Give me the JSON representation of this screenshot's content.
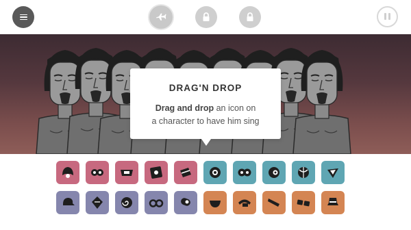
{
  "topbar": {
    "menu_icon": "hamburger-menu-icon",
    "modes": [
      {
        "name": "airplane-mode",
        "icon": "airplane-icon",
        "locked": false
      },
      {
        "name": "locked-mode-1",
        "icon": "lock-icon",
        "locked": true
      },
      {
        "name": "locked-mode-2",
        "icon": "lock-icon",
        "locked": true
      }
    ],
    "pause_icon": "pause-icon"
  },
  "tooltip": {
    "title": "DRAG'N DROP",
    "body_bold": "Drag and drop",
    "body_rest_line1": " an icon on",
    "body_line2": "a character to have him sing"
  },
  "stage": {
    "character_count": 9
  },
  "palette": {
    "colors": {
      "pink": "#c7697f",
      "teal": "#5fa6b3",
      "slate": "#8586ad",
      "orange": "#d48553",
      "glyph": "#1e1e1e"
    },
    "rows": [
      [
        {
          "group": "pink",
          "icon": "helmet-icon"
        },
        {
          "group": "pink",
          "icon": "goggles-icon"
        },
        {
          "group": "pink",
          "icon": "collar-icon"
        },
        {
          "group": "pink",
          "icon": "speaker-box-icon"
        },
        {
          "group": "pink",
          "icon": "gift-box-icon"
        },
        {
          "group": "teal",
          "icon": "disc-icon"
        },
        {
          "group": "teal",
          "icon": "double-disc-icon"
        },
        {
          "group": "teal",
          "icon": "record-icon"
        },
        {
          "group": "teal",
          "icon": "ball-icon"
        },
        {
          "group": "teal",
          "icon": "cone-icon"
        }
      ],
      [
        {
          "group": "slate",
          "icon": "cap-icon"
        },
        {
          "group": "slate",
          "icon": "diamond-icon"
        },
        {
          "group": "slate",
          "icon": "spiral-icon"
        },
        {
          "group": "slate",
          "icon": "glasses-icon"
        },
        {
          "group": "slate",
          "icon": "microphone-icon"
        },
        {
          "group": "orange",
          "icon": "bowl-icon"
        },
        {
          "group": "orange",
          "icon": "headband-icon"
        },
        {
          "group": "orange",
          "icon": "pipe-icon"
        },
        {
          "group": "orange",
          "icon": "shades-icon"
        },
        {
          "group": "orange",
          "icon": "hat-icon"
        }
      ]
    ]
  }
}
